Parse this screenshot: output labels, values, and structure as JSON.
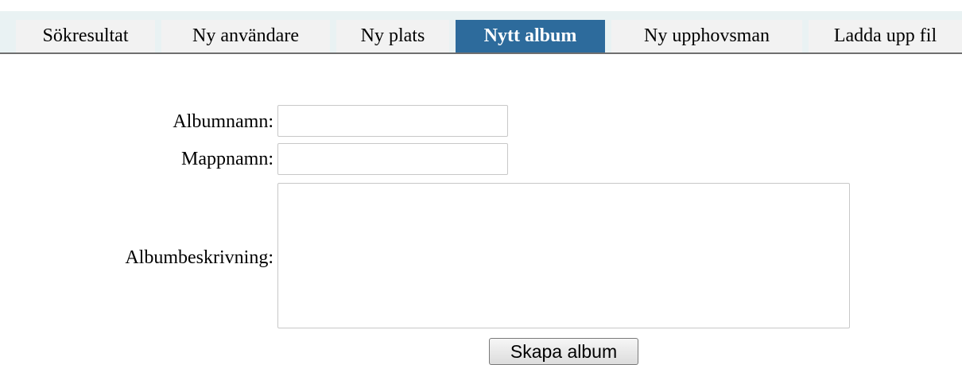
{
  "tabs": [
    {
      "label": "Sökresultat",
      "active": false
    },
    {
      "label": "Ny användare",
      "active": false
    },
    {
      "label": "Ny plats",
      "active": false
    },
    {
      "label": "Nytt album",
      "active": true
    },
    {
      "label": "Ny upphovsman",
      "active": false
    },
    {
      "label": "Ladda upp fil",
      "active": false
    }
  ],
  "colors": {
    "active_tab_bg": "#2d6b9c",
    "inactive_tab_bg": "#f2f2f2",
    "tabbar_bg": "#e9f2f3"
  },
  "form": {
    "albumnamn_label": "Albumnamn:",
    "albumnamn_value": "",
    "mappnamn_label": "Mappnamn:",
    "mappnamn_value": "",
    "beskrivning_label": "Albumbeskrivning:",
    "beskrivning_value": "",
    "submit_label": "Skapa album"
  }
}
